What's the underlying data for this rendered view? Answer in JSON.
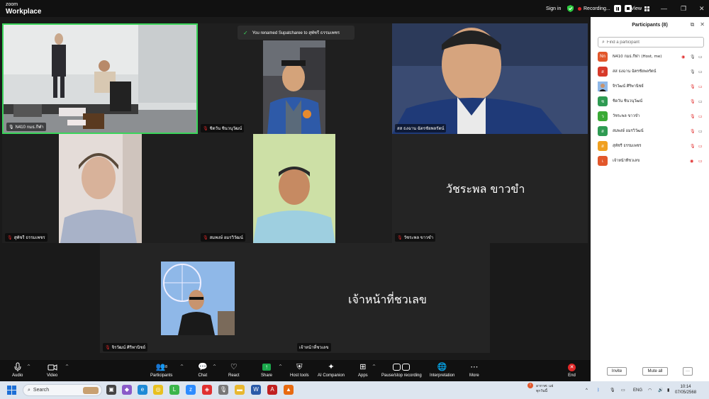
{
  "titlebar": {
    "logo_line1": "zoom",
    "logo_line2": "Workplace",
    "sign_in": "Sign in",
    "recording": "Recording...",
    "view": "View"
  },
  "toast": {
    "text": "You renamed Supatcharee to สุพัชรี ธรรมเพชร"
  },
  "tiles": {
    "t1_name": "N410 กมธ.กีฬา",
    "t2_name": "ชิดวัน ชินวนุวัฒน์",
    "t3_name": "สส ธงฉาน ฉัตรชัยพลรัตน์",
    "t4_name": "สุพัชรี ธรรมเพชร",
    "t5_name": "สมพงษ์ อมรวิวัฒน์",
    "t6_big": "วัชระพล ขาวขำ",
    "t6_name": "วัชระพล ขาวขำ",
    "t7_name": "จิรวัฒน์ ศิริพานิชย์",
    "t8_big": "เจ้าหน้าที่ชวเลข",
    "t8_name": "เจ้าหน้าที่ชวเลข"
  },
  "toolbar": {
    "audio": "Audio",
    "video": "Video",
    "participants": "Participants",
    "participants_count": "8",
    "chat": "Chat",
    "react": "React",
    "share": "Share",
    "host_tools": "Host tools",
    "ai_companion": "AI Companion",
    "apps": "Apps",
    "pause_stop": "Pause/stop recording",
    "interpretation": "Interpretation",
    "more": "More",
    "end": "End"
  },
  "panel": {
    "title": "Participants (8)",
    "search_placeholder": "Find a participant",
    "participants": [
      {
        "initials": "Nn",
        "name": "N410 กมธ.กีฬา (Host, me)",
        "color": "#e2572b"
      },
      {
        "initials": "ส",
        "name": "สส ธงฉาน ฉัตรชัยพลรัตน์",
        "color": "#d73a2a"
      },
      {
        "initials": "",
        "name": "จิรวัฒน์ ศิริพานิชย์",
        "color": "#6b8fb8"
      },
      {
        "initials": "ช",
        "name": "ชิดวัน ชินวนุวัฒน์",
        "color": "#2e9b52"
      },
      {
        "initials": "ว",
        "name": "วัชระพล ขาวขำ",
        "color": "#3aaa35"
      },
      {
        "initials": "ส",
        "name": "สมพงษ์ อมรวิวัฒน์",
        "color": "#2e9b52"
      },
      {
        "initials": "ส",
        "name": "สุพัชรี ธรรมเพชร",
        "color": "#f0a020"
      },
      {
        "initials": "เ",
        "name": "เจ้าหน้าที่ชวเลข",
        "color": "#e2572b"
      }
    ],
    "invite": "Invite",
    "mute_all": "Mute all",
    "more": "···"
  },
  "taskbar": {
    "search": "Search",
    "weather_line1": "อากาศ: แย่",
    "weather_line2": "ทุกวันนี้",
    "language": "ENG",
    "time": "10:14",
    "date": "07/05/2568"
  },
  "colors": {
    "accent_green": "#3ad45a",
    "end_red": "#e02828",
    "share_green": "#1ba94c"
  }
}
